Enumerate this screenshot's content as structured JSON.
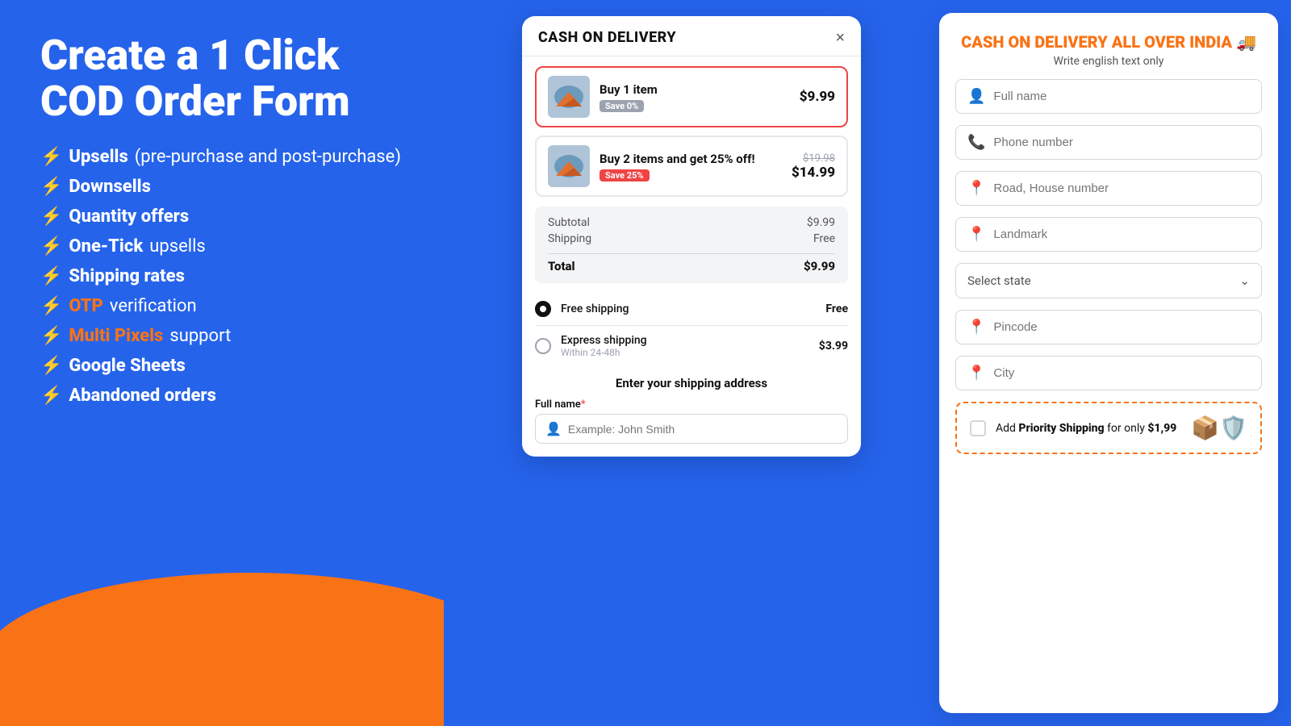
{
  "left": {
    "title": "Create a 1 Click COD Order Form",
    "features": [
      {
        "bolt": "⚡",
        "highlight": "Upsells",
        "sub": "(pre-purchase and post-purchase)"
      },
      {
        "bolt": "⚡",
        "highlight": "Downsells",
        "sub": ""
      },
      {
        "bolt": "⚡",
        "highlight": "Quantity offers",
        "sub": ""
      },
      {
        "bolt": "⚡",
        "highlight": "One-Tick",
        "sub": "upsells"
      },
      {
        "bolt": "⚡",
        "highlight": "Shipping rates",
        "sub": ""
      },
      {
        "bolt": "⚡",
        "highlight": "OTP",
        "sub": "verification"
      },
      {
        "bolt": "⚡",
        "highlight": "Multi Pixels",
        "sub": "support"
      },
      {
        "bolt": "⚡",
        "highlight": "Google Sheets",
        "sub": ""
      },
      {
        "bolt": "⚡",
        "highlight": "Abandoned orders",
        "sub": ""
      }
    ]
  },
  "modal": {
    "title": "CASH ON DELIVERY",
    "close": "×",
    "product1": {
      "name": "Buy 1 item",
      "badge": "Save 0%",
      "badge_color": "gray",
      "price": "$9.99",
      "selected": true
    },
    "product2": {
      "name": "Buy 2 items and get 25% off!",
      "badge": "Save 25%",
      "badge_color": "orange",
      "price_original": "$19.98",
      "price": "$14.99",
      "selected": false
    },
    "subtotal_label": "Subtotal",
    "subtotal_value": "$9.99",
    "shipping_label": "Shipping",
    "shipping_value": "Free",
    "total_label": "Total",
    "total_value": "$9.99",
    "shipping_option1_name": "Free shipping",
    "shipping_option1_price": "Free",
    "shipping_option1_selected": true,
    "shipping_option2_name": "Express shipping",
    "shipping_option2_sub": "Within 24-48h",
    "shipping_option2_price": "$3.99",
    "shipping_option2_selected": false,
    "address_title": "Enter your shipping address",
    "fullname_label": "Full name",
    "fullname_required": "*",
    "fullname_placeholder": "Example: John Smith"
  },
  "right": {
    "header_title": "CASH ON DELIVERY ALL OVER INDIA 🚚",
    "header_sub": "Write english text only",
    "fullname_placeholder": "Full name",
    "phone_placeholder": "Phone number",
    "road_placeholder": "Road, House number",
    "landmark_placeholder": "Landmark",
    "state_placeholder": "Select state",
    "pincode_placeholder": "Pincode",
    "city_placeholder": "City",
    "priority_text1": "Add ",
    "priority_bold": "Priority Shipping",
    "priority_text2": " for only ",
    "priority_price": "$1,99"
  }
}
